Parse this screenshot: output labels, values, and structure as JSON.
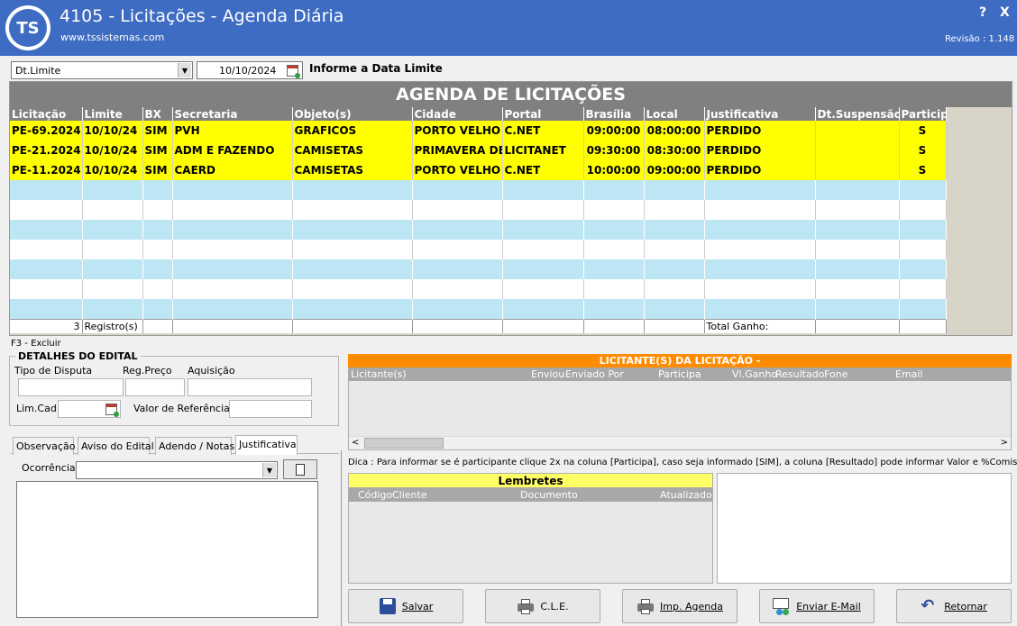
{
  "window": {
    "logo": "TS",
    "title": "4105 - Licitações  - Agenda Diária",
    "url": "www.tssistemas.com",
    "help": "?",
    "close": "X",
    "revision": "Revisão : 1.148"
  },
  "filter": {
    "field_selected": "Dt.Limite",
    "date_value": "10/10/2024",
    "label": "Informe a Data Limite"
  },
  "grid": {
    "title": "AGENDA DE LICITAÇÕES",
    "columns": [
      "Licitação",
      "Limite",
      "BX",
      "Secretaria",
      "Objeto(s)",
      "Cidade",
      "Portal",
      "Brasília",
      "Local",
      "Justificativa",
      "Dt.Suspensão",
      "Particip"
    ],
    "rows": [
      [
        "PE-69.2024",
        "10/10/24",
        "SIM",
        "PVH",
        "GRAFICOS",
        "PORTO VELHO",
        "C.NET",
        "09:00:00",
        "08:00:00",
        "PERDIDO",
        "",
        "S"
      ],
      [
        "PE-21.2024",
        "10/10/24",
        "SIM",
        "ADM E FAZENDO",
        "CAMISETAS",
        "PRIMAVERA DE",
        "LICITANET",
        "09:30:00",
        "08:30:00",
        "PERDIDO",
        "",
        "S"
      ],
      [
        "PE-11.2024",
        "10/10/24",
        "SIM",
        "CAERD",
        "CAMISETAS",
        "PORTO VELHO",
        "C.NET",
        "10:00:00",
        "09:00:00",
        "PERDIDO",
        "",
        "S"
      ]
    ],
    "footer_count": "3",
    "footer_records": "Registro(s)",
    "footer_total": "Total Ganho:"
  },
  "hint_delete": "F3 - Excluir",
  "details": {
    "title": "DETALHES DO EDITAL",
    "tipo_disputa": "Tipo de Disputa",
    "reg_preco": "Reg.Preço",
    "aquisicao": "Aquisição",
    "lim_cad": "Lim.Cad",
    "valor_referencia": "Valor de Referência"
  },
  "tabs": [
    "Observação",
    "Aviso do Edital",
    "Adendo / Notas",
    "Justificativa"
  ],
  "ocorrencia_label": "Ocorrência",
  "licitantes": {
    "title": "LICITANTE(S) DA LICITAÇÃO  -",
    "columns": [
      "Licitante(s)",
      "Enviou",
      "Enviado Por",
      "Participa",
      "Vl.Ganho",
      "Resultado",
      "Fone",
      "Email"
    ]
  },
  "tip": "Dica : Para informar se é participante clique 2x na coluna [Participa], caso seja informado [SIM], a coluna [Resultado] pode informar Valor e %Comissão",
  "lembretes": {
    "title": "Lembretes",
    "columns": [
      "Código",
      "Cliente",
      "Documento",
      "Atualizado"
    ]
  },
  "buttons": {
    "salvar": "Salvar",
    "cle": "C.L.E.",
    "imp_agenda": "Imp. Agenda",
    "enviar_email": "Enviar E-Mail",
    "retornar": "Retornar"
  },
  "colors": {
    "titlebar": "#3e6cc2",
    "highlight_row": "#ffff00",
    "stripe": "#bde6f5",
    "licitantes_header": "#ff8c00",
    "lembretes_header": "#ffff66"
  }
}
